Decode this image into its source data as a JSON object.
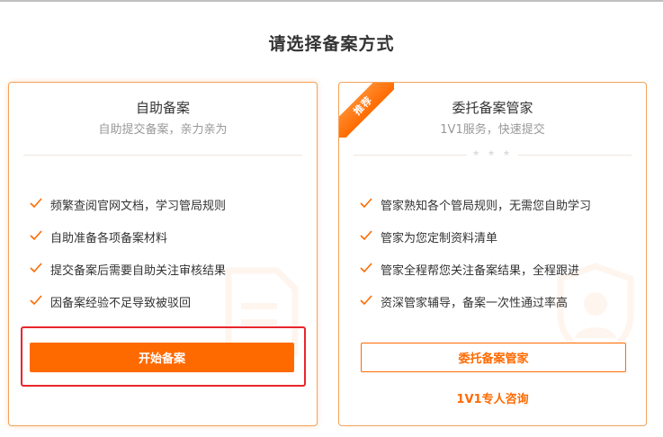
{
  "page": {
    "title": "请选择备案方式"
  },
  "self_service": {
    "title": "自助备案",
    "subtitle": "自助提交备案，亲力亲为",
    "features": [
      "频繁查阅官网文档，学习管局规则",
      "自助准备各项备案材料",
      "提交备案后需要自助关注审核结果",
      "因备案经验不足导致被驳回"
    ],
    "button": "开始备案"
  },
  "managed": {
    "badge": "推荐",
    "title": "委托备案管家",
    "subtitle": "1V1服务，快速提交",
    "features": [
      "管家熟知各个管局规则，无需您自助学习",
      "管家为您定制资料清单",
      "管家全程帮您关注备案结果，全程跟进",
      "资深管家辅导，备案一次性通过率高"
    ],
    "button": "委托备案管家",
    "consult_link": "1V1专人咨询"
  },
  "colors": {
    "accent": "#ff6a00",
    "border": "#f3a25a",
    "highlight": "#e8262b"
  },
  "icons": {
    "check": "check-icon",
    "left_watermark": "document-icon",
    "right_watermark": "user-icon"
  }
}
